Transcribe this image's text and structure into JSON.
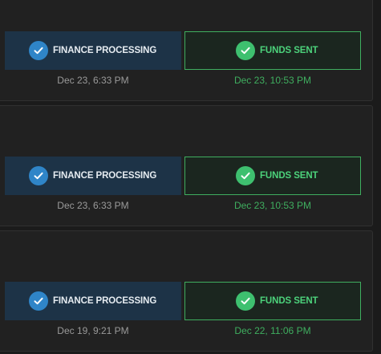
{
  "colors": {
    "page_background": "#1b1b1b",
    "card_background": "#212121",
    "finance_step_background": "#1d3347",
    "finance_badge": "#2f85c8",
    "funds_step_background": "#1b261f",
    "funds_accent": "#3fae5f",
    "funds_badge": "#3ec06f",
    "timestamp_gray": "#9a9a9a"
  },
  "icons": {
    "finance_step": "check-circle-icon",
    "funds_step": "check-circle-icon"
  },
  "orders": [
    {
      "finance_label": "FINANCE PROCESSING",
      "finance_time": "Dec 23, 6:33 PM",
      "funds_label": "FUNDS SENT",
      "funds_time": "Dec 23, 10:53 PM"
    },
    {
      "finance_label": "FINANCE PROCESSING",
      "finance_time": "Dec 23, 6:33 PM",
      "funds_label": "FUNDS SENT",
      "funds_time": "Dec 23, 10:53 PM"
    },
    {
      "finance_label": "FINANCE PROCESSING",
      "finance_time": "Dec 19, 9:21 PM",
      "funds_label": "FUNDS SENT",
      "funds_time": "Dec 22, 11:06 PM"
    }
  ]
}
